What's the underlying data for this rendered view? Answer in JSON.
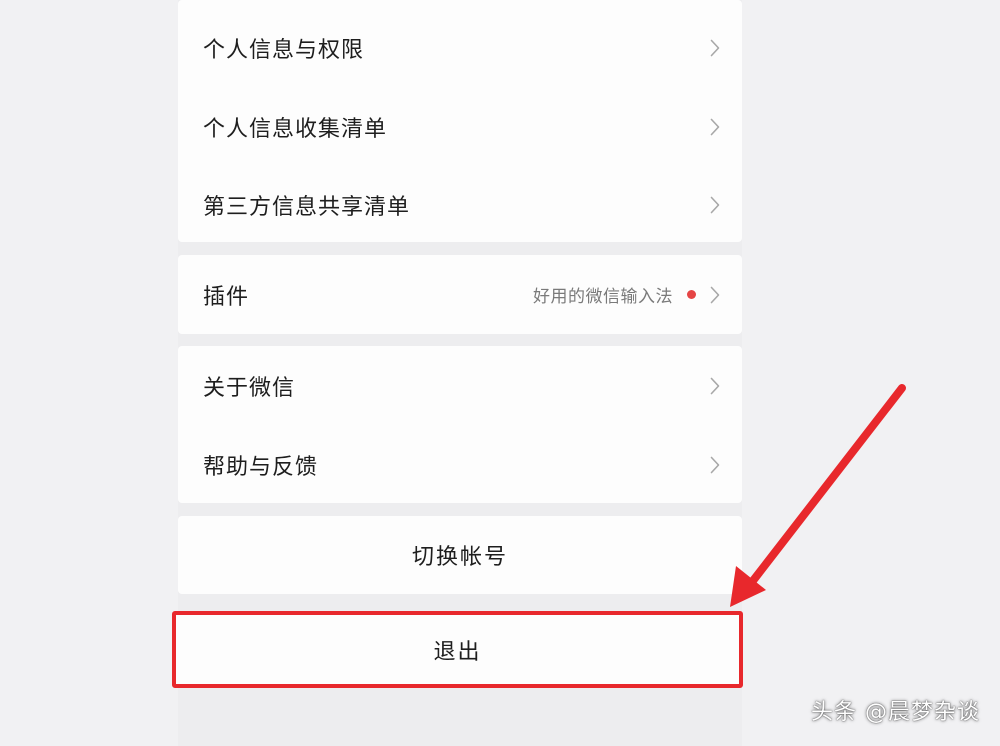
{
  "privacy_group": {
    "items": [
      {
        "label": "个人信息与权限"
      },
      {
        "label": "个人信息收集清单"
      },
      {
        "label": "第三方信息共享清单"
      }
    ]
  },
  "plugins_row": {
    "label": "插件",
    "description": "好用的微信输入法",
    "badge_color": "#e54545"
  },
  "about_group": {
    "items": [
      {
        "label": "关于微信"
      },
      {
        "label": "帮助与反馈"
      }
    ]
  },
  "switch_account": {
    "label": "切换帐号"
  },
  "logout": {
    "label": "退出",
    "highlight_color": "#e8282c"
  },
  "watermark": {
    "text": "头条 @晨梦杂谈"
  },
  "icons": {
    "row_chevron": "chevron-right-icon",
    "annotation": "red-arrow-icon"
  }
}
